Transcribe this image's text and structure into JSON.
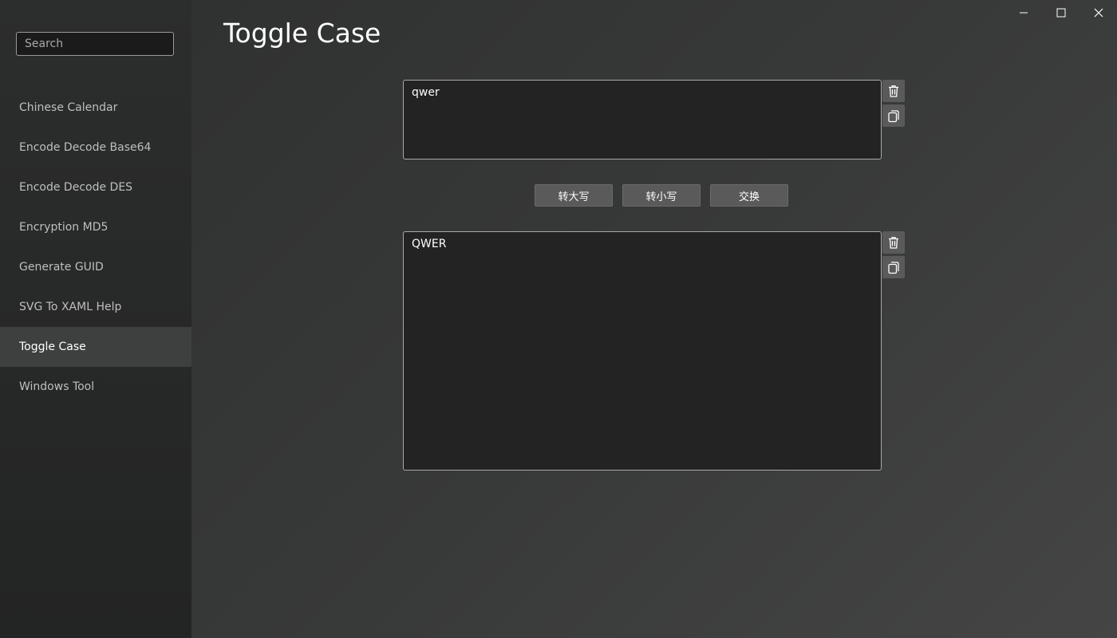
{
  "window": {
    "minimize_icon": "minimize-icon",
    "maximize_icon": "maximize-icon",
    "close_icon": "close-icon"
  },
  "sidebar": {
    "search": {
      "placeholder": "Search",
      "value": ""
    },
    "items": [
      {
        "label": "Chinese Calendar",
        "active": false
      },
      {
        "label": "Encode Decode Base64",
        "active": false
      },
      {
        "label": "Encode Decode DES",
        "active": false
      },
      {
        "label": "Encryption MD5",
        "active": false
      },
      {
        "label": "Generate GUID",
        "active": false
      },
      {
        "label": "SVG To XAML Help",
        "active": false
      },
      {
        "label": "Toggle Case",
        "active": true
      },
      {
        "label": "Windows Tool",
        "active": false
      }
    ]
  },
  "main": {
    "title": "Toggle Case",
    "input": {
      "value": "qwer",
      "clear_icon": "trash-icon",
      "copy_icon": "copy-icon"
    },
    "actions": {
      "upper_label": "转大写",
      "lower_label": "转小写",
      "swap_label": "交换"
    },
    "output": {
      "value": "QWER",
      "clear_icon": "trash-icon",
      "copy_icon": "copy-icon"
    }
  },
  "colors": {
    "background": "#383939",
    "sidebar": "#282929",
    "active_item": "#3e3f3f",
    "button": "#5a5a5a",
    "textbox": "#232323"
  }
}
